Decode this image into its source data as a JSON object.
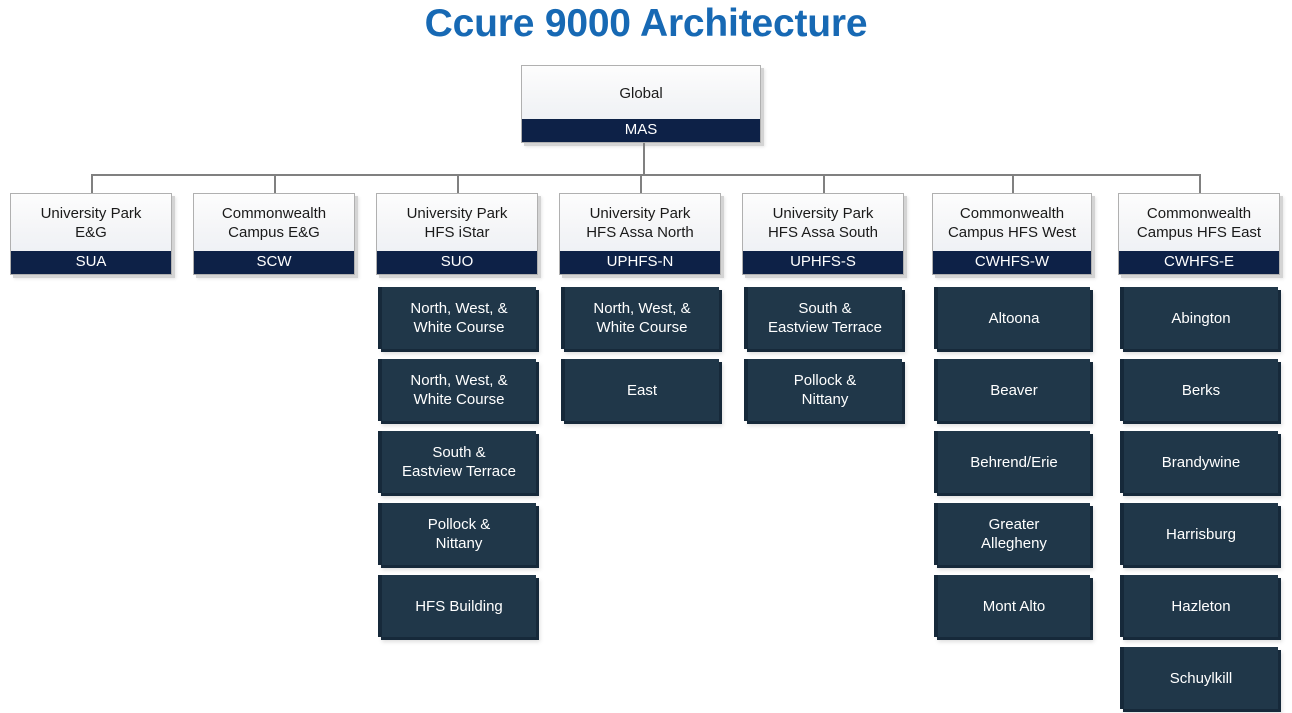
{
  "title": "Ccure 9000 Architecture",
  "colors": {
    "title_blue": "#1769b4",
    "node_code_navy": "#0d2147",
    "node_dark_fill": "#203749",
    "node_dark_bevel": "#16293a",
    "connector_gray": "#808080"
  },
  "root": {
    "title": "Global",
    "code": "MAS"
  },
  "branches": [
    {
      "title": "University Park\nE&G",
      "code": "SUA",
      "children": []
    },
    {
      "title": "Commonwealth\nCampus E&G",
      "code": "SCW",
      "children": []
    },
    {
      "title": "University Park\nHFS iStar",
      "code": "SUO",
      "children": [
        "North, West, &\nWhite Course",
        "North, West, &\nWhite Course",
        "South &\nEastview Terrace",
        "Pollock &\nNittany",
        "HFS Building"
      ]
    },
    {
      "title": "University Park\nHFS Assa North",
      "code": "UPHFS-N",
      "children": [
        "North, West, &\nWhite Course",
        "East"
      ]
    },
    {
      "title": "University Park\nHFS Assa South",
      "code": "UPHFS-S",
      "children": [
        "South &\nEastview Terrace",
        "Pollock &\nNittany"
      ]
    },
    {
      "title": "Commonwealth\nCampus HFS West",
      "code": "CWHFS-W",
      "children": [
        "Altoona",
        "Beaver",
        "Behrend/Erie",
        "Greater\nAllegheny",
        "Mont Alto"
      ]
    },
    {
      "title": "Commonwealth\nCampus HFS East",
      "code": "CWHFS-E",
      "children": [
        "Abington",
        "Berks",
        "Brandywine",
        "Harrisburg",
        "Hazleton",
        "Schuylkill"
      ]
    }
  ]
}
